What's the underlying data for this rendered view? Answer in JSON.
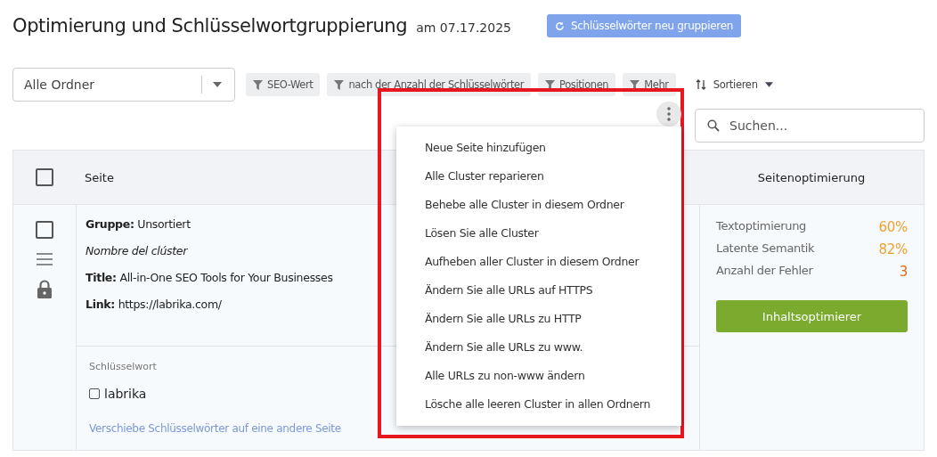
{
  "header": {
    "title": "Optimierung und Schlüsselwortgruppierung",
    "date": "am 07.17.2025",
    "regroup_button": "Schlüsselwörter neu gruppieren"
  },
  "folder_select": {
    "value": "Alle Ordner"
  },
  "filters": [
    "SEO-Wert",
    "nach der Anzahl der Schlüsselwörter",
    "Positionen",
    "Mehr"
  ],
  "sort": {
    "label": "Sortieren"
  },
  "search": {
    "placeholder": "Suchen..."
  },
  "menu": {
    "open": true,
    "items": [
      "Neue Seite hinzufügen",
      "Alle Cluster reparieren",
      "Behebe alle Cluster in diesem Ordner",
      "Lösen Sie alle Cluster",
      "Aufheben aller Cluster in diesem Ordner",
      "Ändern Sie alle URLs auf HTTPS",
      "Ändern Sie alle URLs zu HTTP",
      "Ändern Sie alle URLs zu www.",
      "Alle URLs zu non-www ändern",
      "Lösche alle leeren Cluster in allen Ordnern"
    ]
  },
  "table": {
    "header_checked": false,
    "columns": [
      "Seite",
      "Seitenoptimierung"
    ],
    "rows": [
      {
        "checked": false,
        "locked": true,
        "lines": [
          "**Gruppe:** Unsortiert",
          "*Nombre del clúster*",
          "**Title:** All-in-One SEO Tools for Your Businesses",
          "**Link:** https://labrika.com/"
        ],
        "keyword_header": "Schlüsselwort",
        "keywords": [
          {
            "text": "labrika",
            "checked": false
          }
        ],
        "move_link": "Verschiebe Schlüsselwörter auf eine andere Seite",
        "metrics": [
          {
            "label": "Textoptimierung",
            "value": "60%",
            "color": "#f0a030"
          },
          {
            "label": "Latente Semantik",
            "value": "82%",
            "color": "#f0a030"
          },
          {
            "label": "Anzahl der Fehler",
            "value": "3",
            "color": "#e06a1a"
          }
        ],
        "optimizer_button": "Inhaltsoptimierer"
      }
    ]
  }
}
